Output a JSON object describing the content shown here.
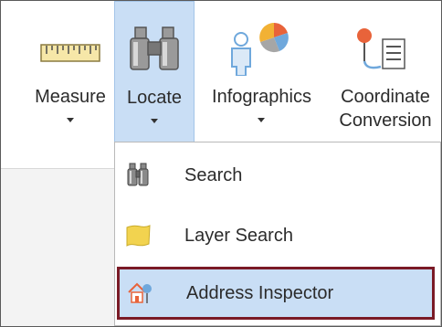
{
  "ribbon": {
    "tools": [
      {
        "id": "measure",
        "label": "Measure",
        "label2": "",
        "icon": "ruler-icon",
        "has_dropdown": true
      },
      {
        "id": "locate",
        "label": "Locate",
        "label2": "",
        "icon": "binoculars-icon",
        "has_dropdown": true,
        "active": true
      },
      {
        "id": "infographics",
        "label": "Infographics",
        "label2": "",
        "icon": "person-pie-icon",
        "has_dropdown": true
      },
      {
        "id": "coordinate",
        "label": "Coordinate",
        "label2": "Conversion",
        "icon": "coordinate-conversion-icon",
        "has_dropdown": false
      }
    ]
  },
  "menu": {
    "items": [
      {
        "label": "Search",
        "icon": "binoculars-icon"
      },
      {
        "label": "Layer Search",
        "icon": "layer-polygon-icon"
      },
      {
        "label": "Address Inspector",
        "icon": "house-pin-icon",
        "highlighted": true
      }
    ]
  },
  "colors": {
    "active_bg": "#c9def5",
    "highlight_border": "#7a1a26",
    "accent_orange": "#e8633a",
    "accent_blue": "#6fa8dc"
  }
}
